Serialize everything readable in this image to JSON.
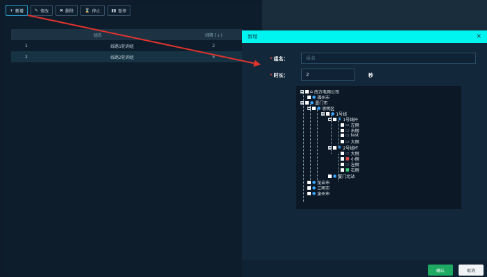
{
  "toolbar": {
    "add": "新增",
    "edit": "修改",
    "delete": "删除",
    "stop": "停止",
    "pause": "暂停",
    "icons": {
      "add": "+",
      "edit": "✎",
      "delete": "✖",
      "stop": "⌛",
      "pause": "▮▮"
    }
  },
  "table": {
    "headers": {
      "name": "组名",
      "interval": "间隔 ( s )"
    },
    "rows": [
      {
        "index": "1",
        "name": "线路1轮询组",
        "interval": "2"
      },
      {
        "index": "2",
        "name": "线路2轮询组",
        "interval": "5"
      }
    ]
  },
  "modal": {
    "title": "新增",
    "close": "✕",
    "group_label": "组名：",
    "group_placeholder": "组名",
    "duration_label": "时长：",
    "duration_value": "2",
    "unit": "秒",
    "star": "*",
    "confirm": "确认",
    "cancel": "取消"
  },
  "tree": {
    "root": "南方电网公司",
    "fuzhou": "福州市",
    "xiamen": "厦门市",
    "siming": "思明区",
    "line1": "1号线",
    "pole1": "1号线杆",
    "left1": "左侧",
    "right1": "右侧",
    "test": "test",
    "big1": "大侧",
    "pole2": "2号线杆",
    "big2": "大侧",
    "small2": "小侧",
    "left2": "左侧",
    "right2": "右侧",
    "xiamen_north": "厦门北站",
    "longyan": "龙岩市",
    "sanming": "三明市",
    "quanzhou": "泉州市"
  },
  "colors": {
    "header_accent": "#00f5f0",
    "confirm": "#1faa63",
    "arrow": "#e0342e"
  }
}
